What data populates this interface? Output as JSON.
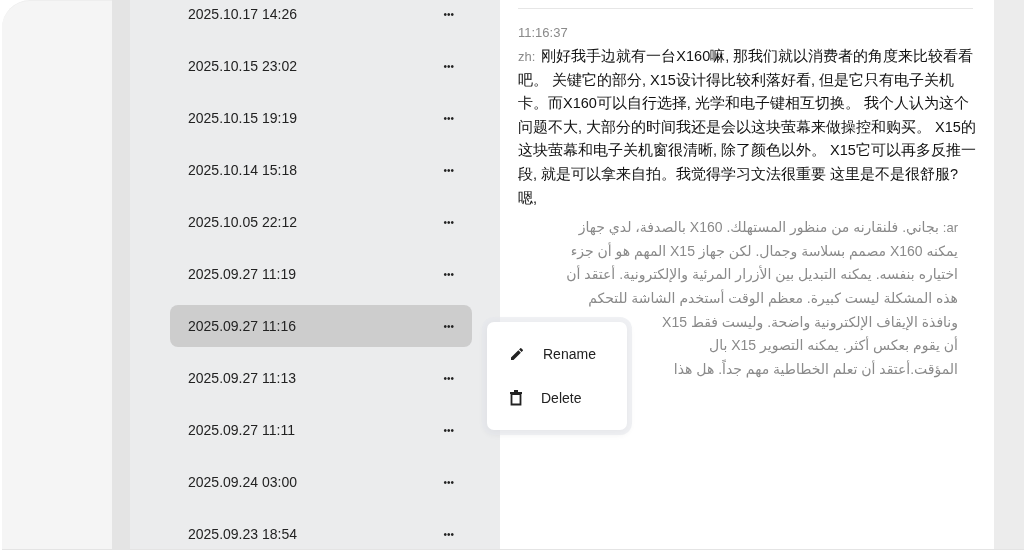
{
  "sessions": [
    {
      "label": "2025.10.17 14:26",
      "selected": false
    },
    {
      "label": "2025.10.15 23:02",
      "selected": false
    },
    {
      "label": "2025.10.15 19:19",
      "selected": false
    },
    {
      "label": "2025.10.14 15:18",
      "selected": false
    },
    {
      "label": "2025.10.05 22:12",
      "selected": false
    },
    {
      "label": "2025.09.27 11:19",
      "selected": false
    },
    {
      "label": "2025.09.27 11:16",
      "selected": true
    },
    {
      "label": "2025.09.27 11:13",
      "selected": false
    },
    {
      "label": "2025.09.27 11:11",
      "selected": false
    },
    {
      "label": "2025.09.24 03:00",
      "selected": false
    },
    {
      "label": "2025.09.23 18:54",
      "selected": false
    }
  ],
  "session_menu_button": "•••",
  "message": {
    "time": "11:16:37",
    "chinese": {
      "lang": "zh:",
      "text": "刚好我手边就有一台X160嘛, 那我们就以消费者的角度来比较看看吧。 关键它的部分, X15设计得比较利落好看, 但是它只有电子关机卡。而X160可以自行选择, 光学和电子键相互切换。 我个人认为这个问题不大, 大部分的时间我还是会以这块萤幕来做操控和购买。 X15的这块萤幕和电子关机窗很清晰, 除了颜色以外。 X15它可以再多反推一段, 就是可以拿来自拍。我觉得学习文法很重要 这里是不是很舒服? 嗯,"
    },
    "arabic": {
      "lang": "ar:",
      "lines": [
        "بجاني. فلنقارنه من منظور المستهلك. X160 بالصدفة، لدي جهاز",
        "يمكنه X160 مصمم بسلاسة وجمال. لكن جهاز X15 المهم هو أن جزء",
        "اختياره بنفسه. يمكنه التبديل بين الأزرار المرئية والإلكترونية. أعتقد أن",
        "هذه المشكلة ليست كبيرة. معظم الوقت أستخدم الشاشة للتحكم",
        "ونافذة الإيقاف الإلكترونية واضحة. وليست فقط X15",
        "أن يقوم بعكس أكثر. يمكنه التصوير X15 بال",
        "المؤقت.أعتقد أن تعلم الخطاطية مهم جداً. هل هذا"
      ]
    }
  },
  "context_menu": {
    "items": [
      {
        "kind": "rename",
        "label": "Rename"
      },
      {
        "kind": "delete",
        "label": "Delete"
      }
    ]
  }
}
